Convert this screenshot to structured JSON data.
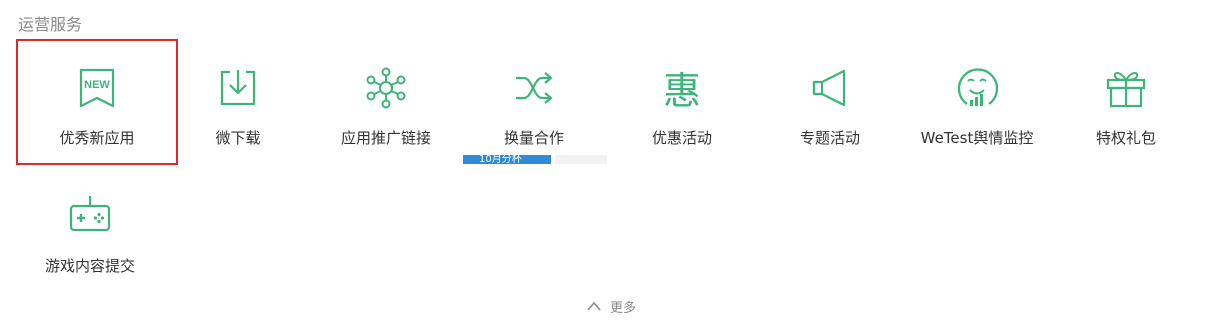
{
  "section": {
    "title": "运营服务"
  },
  "services": [
    {
      "label": "优秀新应用",
      "icon": "new-badge-icon",
      "icon_text": "NEW"
    },
    {
      "label": "微下载",
      "icon": "download-icon"
    },
    {
      "label": "应用推广链接",
      "icon": "link-network-icon"
    },
    {
      "label": "换量合作",
      "icon": "shuffle-icon"
    },
    {
      "label": "优惠活动",
      "icon": "hui-character-icon",
      "icon_text": "惠"
    },
    {
      "label": "专题活动",
      "icon": "megaphone-icon"
    },
    {
      "label": "WeTest舆情监控",
      "icon": "smiley-chart-icon"
    },
    {
      "label": "特权礼包",
      "icon": "gift-icon"
    },
    {
      "label": "游戏内容提交",
      "icon": "gamepad-icon"
    }
  ],
  "partial_badge": {
    "text": "10月分杯"
  },
  "more": {
    "label": "更多"
  },
  "colors": {
    "accent": "#3db57a",
    "highlight_border": "#e0292e",
    "badge_blue": "#2f8ad8",
    "label": "#333333",
    "muted": "#8a8a8a"
  }
}
